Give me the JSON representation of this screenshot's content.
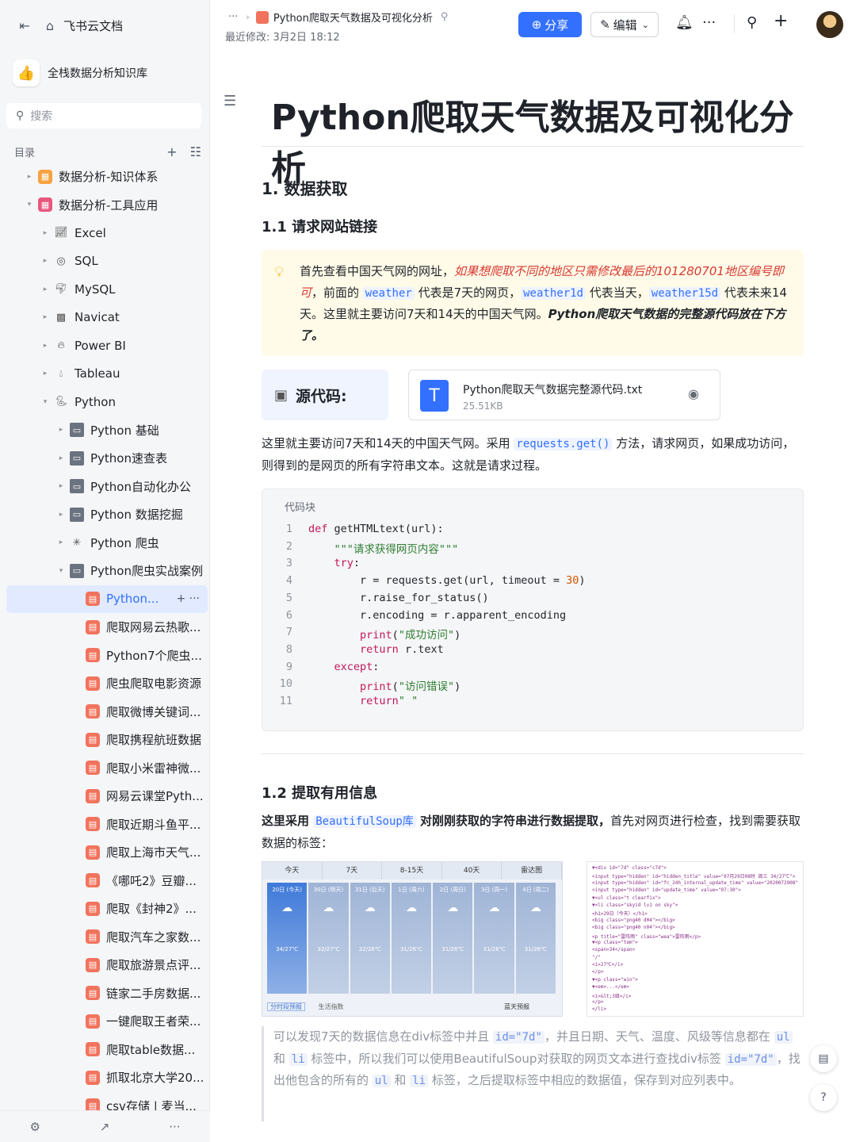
{
  "app": {
    "name": "飞书云文档"
  },
  "knowledge_base": {
    "name": "全栈数据分析知识库"
  },
  "search": {
    "placeholder": "搜索"
  },
  "toc": {
    "label": "目录"
  },
  "tree": [
    {
      "label": "数据分析-知识体系",
      "level": 0,
      "expanded": false,
      "icon": "orange"
    },
    {
      "label": "数据分析-工具应用",
      "level": 0,
      "expanded": true,
      "icon": "pink"
    },
    {
      "label": "Excel",
      "level": 1,
      "expanded": false,
      "icon": "excel"
    },
    {
      "label": "SQL",
      "level": 1,
      "expanded": false,
      "icon": "sql"
    },
    {
      "label": "MySQL",
      "level": 1,
      "expanded": false,
      "icon": "mysql"
    },
    {
      "label": "Navicat",
      "level": 1,
      "expanded": false,
      "icon": "navicat"
    },
    {
      "label": "Power BI",
      "level": 1,
      "expanded": false,
      "icon": "powerbi"
    },
    {
      "label": "Tableau",
      "level": 1,
      "expanded": false,
      "icon": "tableau"
    },
    {
      "label": "Python",
      "level": 1,
      "expanded": true,
      "icon": "python"
    },
    {
      "label": "Python 基础",
      "level": 2,
      "expanded": false,
      "icon": "folder"
    },
    {
      "label": "Python速查表",
      "level": 2,
      "expanded": false,
      "icon": "folder"
    },
    {
      "label": "Python自动化办公",
      "level": 2,
      "expanded": false,
      "icon": "folder"
    },
    {
      "label": "Python 数据挖掘",
      "level": 2,
      "expanded": false,
      "icon": "folder"
    },
    {
      "label": "Python 爬虫",
      "level": 2,
      "expanded": false,
      "icon": "spider"
    },
    {
      "label": "Python爬虫实战案例",
      "level": 2,
      "expanded": true,
      "icon": "folder"
    },
    {
      "label": "Python...",
      "level": 3,
      "selected": true,
      "icon": "doc"
    },
    {
      "label": "爬取网易云热歌...",
      "level": 3,
      "icon": "doc"
    },
    {
      "label": "Python7个爬虫...",
      "level": 3,
      "icon": "doc"
    },
    {
      "label": "爬虫爬取电影资源",
      "level": 3,
      "icon": "doc"
    },
    {
      "label": "爬取微博关键词...",
      "level": 3,
      "icon": "doc"
    },
    {
      "label": "爬取携程航班数据",
      "level": 3,
      "icon": "doc"
    },
    {
      "label": "爬取小米雷神微...",
      "level": 3,
      "icon": "doc"
    },
    {
      "label": "网易云课堂Pyth...",
      "level": 3,
      "icon": "doc"
    },
    {
      "label": "爬取近期斗鱼平...",
      "level": 3,
      "icon": "doc"
    },
    {
      "label": "爬取上海市天气...",
      "level": 3,
      "icon": "doc"
    },
    {
      "label": "《哪吒2》豆瓣...",
      "level": 3,
      "icon": "doc"
    },
    {
      "label": "爬取《封神2》...",
      "level": 3,
      "icon": "doc"
    },
    {
      "label": "爬取汽车之家数...",
      "level": 3,
      "icon": "doc"
    },
    {
      "label": "爬取旅游景点评...",
      "level": 3,
      "icon": "doc"
    },
    {
      "label": "链家二手房数据...",
      "level": 3,
      "icon": "doc"
    },
    {
      "label": "一键爬取王者荣...",
      "level": 3,
      "icon": "doc"
    },
    {
      "label": "爬取table数据...",
      "level": 3,
      "icon": "doc"
    },
    {
      "label": "抓取北京大学20...",
      "level": 3,
      "icon": "doc"
    },
    {
      "label": "csv存储 | 麦当...",
      "level": 3,
      "icon": "doc"
    }
  ],
  "header": {
    "breadcrumb_dots": "···",
    "breadcrumb_title": "Python爬取天气数据及可视化分析",
    "modified": "最近修改: 3月2日 18:12",
    "share_label": "分享",
    "edit_label": "编辑"
  },
  "doc": {
    "title": "Python爬取天气数据及可视化分析",
    "h1": "1. 数据获取",
    "h2_1": "1.1 请求网站链接",
    "callout": {
      "t1": "首先查看中国天气网的网址，",
      "red": "如果想爬取不同的地区只需修改最后的101280701地区编号即可",
      "t2": "，前面的 ",
      "c1": "weather",
      "t3": " 代表是7天的网页，",
      "c2": "weather1d",
      "t4": " 代表当天，",
      "c3": "weather15d",
      "t5": " 代表未来14天。这里就主要访问7天和14天的中国天气网。",
      "bold": "Python爬取天气数据的完整源代码放在下方了。"
    },
    "source_label": "源代码:",
    "file": {
      "name": "Python爬取天气数据完整源代码.txt",
      "size": "25.51KB"
    },
    "para1": {
      "t1": "这里就主要访问7天和14天的中国天气网。采用 ",
      "code": "requests.get()",
      "t2": " 方法，请求网页，如果成功访问，则得到的是网页的所有字符串文本。这就是请求过程。"
    },
    "code_label": "代码块",
    "code": [
      "def getHTMLtext(url):",
      "    \"\"\"请求获得网页内容\"\"\"",
      "    try:",
      "        r = requests.get(url, timeout = 30)",
      "        r.raise_for_status()",
      "        r.encoding = r.apparent_encoding",
      "        print(\"成功访问\")",
      "        return r.text",
      "    except:",
      "        print(\"访问错误\")",
      "        return\" \""
    ],
    "h2_2": "1.2 提取有用信息",
    "para2": {
      "t1": "这里采用 ",
      "code": "BeautifulSoup库",
      "t2": " 对刚刚获取的字符串进行数据提取，",
      "t3": "首先对网页进行检查，找到需要获取数据的标签："
    },
    "img1": {
      "tabs": [
        "今天",
        "7天",
        "8-15天",
        "40天",
        "雷达图"
      ],
      "days": [
        "20日 (今天)",
        "30日 (明天)",
        "31日 (后天)",
        "1日 (周六)",
        "2日 (周日)",
        "3日 (周一)",
        "4日 (周二)"
      ],
      "temps": [
        "34/27℃",
        "32/27℃",
        "32/26℃",
        "31/26℃",
        "31/26℃",
        "31/26℃",
        "31/26℃"
      ],
      "bottom_left": "分时段预报",
      "bottom_mid": "生活指数",
      "bottom_right": "蓝天预报"
    },
    "img2_lines": [
      "▼<div id=\"7d\" class=\"c7d\">",
      "  <input type=\"hidden\" id=\"hidden_title\" value=\"07月29日08时 周三 34/27℃\">",
      "  <input type=\"hidden\" id=\"fc_24h_internal_update_time\" value=\"2020072908\">",
      "  <input type=\"hidden\" id=\"update_time\" value=\"07:30\">",
      "  ▼<ul class=\"t clearfix\">",
      "    ▼<li class=\"skyid lv1 on sky\">",
      "      <h1>29日（今天）</h1>",
      "      <big class=\"png40 d04\"></big>",
      "      <big class=\"png40 n04\"></big>",
      "      <p title=\"雷阵雨\" class=\"wea\">雷阵雨</p>",
      "      ▼<p class=\"tem\">",
      "        <span>34</span>",
      "        \"/\"",
      "        <i>27℃</i>",
      "      </p>",
      "      ▼<p class=\"win\">",
      "        ▼<em>...</em>",
      "        <i>&lt;3级</i>",
      "      </p>",
      "    </li>"
    ],
    "quote": {
      "t1": "可以发现7天的数据信息在div标签中并且 ",
      "c1": "id=\"7d\"",
      "t2": "，并且日期、天气、温度、风级等信息都在 ",
      "c2": "ul",
      "t3": " 和 ",
      "c3": "li",
      "t4": " 标签中，所以我们可以使用BeautifulSoup对获取的网页文本进行查找div标签 ",
      "c4": "id=\"7d\"",
      "t5": "，找出他包含的所有的 ",
      "c5": "ul",
      "t6": " 和 ",
      "c6": "li",
      "t7": " 标签，之后提取标签中相应的数据值，保存到对应列表中。"
    }
  }
}
